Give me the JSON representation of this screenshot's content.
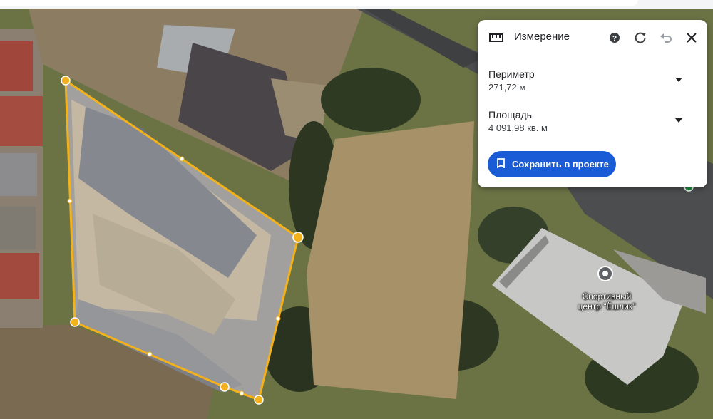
{
  "measure_panel": {
    "title": "Измерение",
    "icons": [
      "ruler-icon",
      "help-icon",
      "refresh-icon",
      "undo-icon",
      "close-icon"
    ],
    "perimeter": {
      "label": "Периметр",
      "value": "271,72 м"
    },
    "area": {
      "label": "Площадь",
      "value": "4 091,98 кв. м"
    },
    "save_button": {
      "label": "Сохранить в проекте",
      "icon": "bookmark-icon"
    },
    "accent_color": "#1a5cd6"
  },
  "map": {
    "poi": {
      "label_line1": "Спортивный",
      "label_line2": "центр \"Ёшлик\"",
      "icon": "map-pin-icon"
    },
    "measurement_color": "#f3b21b"
  }
}
